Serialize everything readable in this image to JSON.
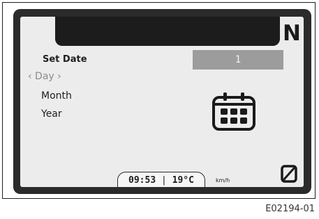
{
  "display": {
    "gear": "N",
    "menu": {
      "title": "Set Date",
      "items": [
        {
          "label": "‹ Day ›",
          "selected": true
        },
        {
          "label": "Month",
          "selected": false
        },
        {
          "label": "Year",
          "selected": false
        }
      ]
    },
    "value": "1",
    "status": {
      "time": "09:53",
      "separator": "|",
      "temperature": "19°C",
      "speed_unit": "km/h"
    },
    "odometer_digit": "0",
    "icon": "calendar-icon"
  },
  "figure_id": "E02194-01",
  "colors": {
    "bezel": "#2b2b2b",
    "screen": "#ececec",
    "value_box": "#9c9c9c",
    "selected_text": "#8a8a8a"
  }
}
